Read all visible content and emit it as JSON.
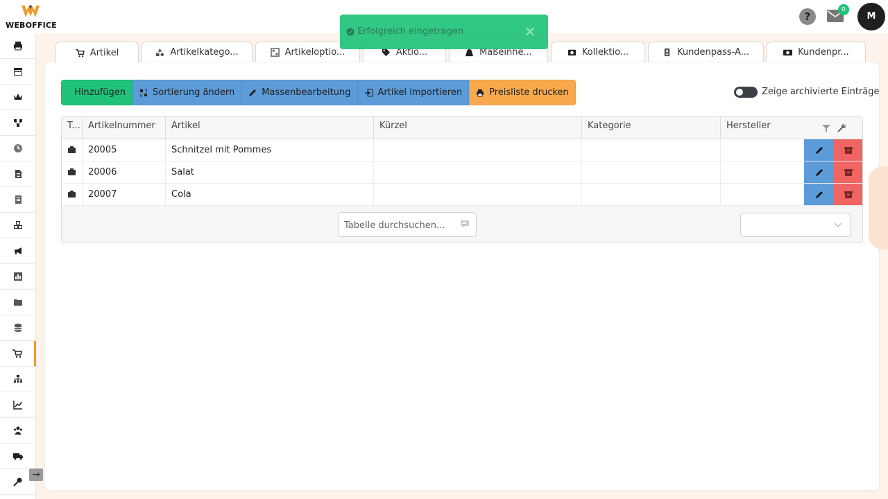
{
  "app": {
    "logo_text": "WEBOFFICE",
    "help_label": "?",
    "mail_count": "0",
    "avatar_initial": "M"
  },
  "toast": {
    "message": "Erfolgreich eingetragen",
    "close_label": "×"
  },
  "sidebar": {
    "items": [
      {
        "icon": "printer-icon"
      },
      {
        "icon": "calendar-icon"
      },
      {
        "icon": "crown-icon"
      },
      {
        "icon": "network-icon"
      },
      {
        "icon": "clock-icon"
      },
      {
        "icon": "document-icon"
      },
      {
        "icon": "list-document-icon"
      },
      {
        "icon": "cubes-icon"
      },
      {
        "icon": "megaphone-icon"
      },
      {
        "icon": "bar-chart-icon"
      },
      {
        "icon": "folder-icon"
      },
      {
        "icon": "database-icon"
      },
      {
        "icon": "cart-icon",
        "active": true
      },
      {
        "icon": "hierarchy-icon"
      },
      {
        "icon": "line-chart-icon"
      },
      {
        "icon": "users-icon"
      },
      {
        "icon": "truck-icon"
      },
      {
        "icon": "key-icon"
      }
    ],
    "toggle_label": "→"
  },
  "tabs": [
    {
      "label": "Artikel",
      "icon": "cart-icon",
      "active": true
    },
    {
      "label": "Artikelkatego...",
      "icon": "shapes-icon"
    },
    {
      "label": "Artikeloptio...",
      "icon": "options-icon"
    },
    {
      "label": "Aktio...",
      "icon": "tag-icon"
    },
    {
      "label": "Maßeinhe...",
      "icon": "weight-icon"
    },
    {
      "label": "Kollektio...",
      "icon": "collection-icon"
    },
    {
      "label": "Kundenpass-A...",
      "icon": "id-card-icon"
    },
    {
      "label": "Kundenpr...",
      "icon": "money-icon"
    }
  ],
  "toolbar": {
    "add_label": "Hinzufügen",
    "sort_label": "Sortierung ändern",
    "bulk_edit_label": "Massenbearbeitung",
    "import_label": "Artikel importieren",
    "print_label": "Preisliste drucken"
  },
  "archive_toggle": {
    "label": "Zeige archivierte Einträge",
    "on": false
  },
  "table": {
    "columns": [
      "T...",
      "Artikelnummer",
      "Artikel",
      "Kürzel",
      "Kategorie",
      "Hersteller"
    ],
    "rows": [
      {
        "type_icon": "box-icon",
        "number": "20005",
        "article": "Schnitzel mit Pommes",
        "short": "",
        "category": "",
        "manufacturer": ""
      },
      {
        "type_icon": "box-icon",
        "number": "20006",
        "article": "Salat",
        "short": "",
        "category": "",
        "manufacturer": ""
      },
      {
        "type_icon": "box-icon",
        "number": "20007",
        "article": "Cola",
        "short": "",
        "category": "",
        "manufacturer": ""
      }
    ],
    "search_placeholder": "Tabelle durchsuchen...",
    "page_size_value": ""
  },
  "colors": {
    "green": "#1fc27a",
    "blue": "#5b9bd8",
    "orange": "#f7a94b",
    "red": "#f16464",
    "accent": "#f39a2c"
  }
}
